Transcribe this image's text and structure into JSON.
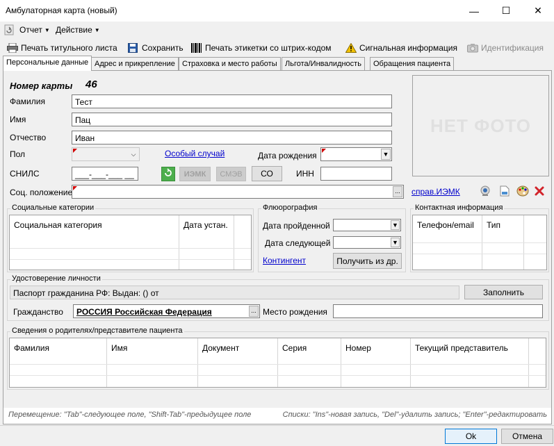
{
  "window": {
    "title": "Амбулаторная карта (новый)",
    "minimize": "—",
    "maximize": "☐",
    "close": "✕"
  },
  "menu": {
    "items": [
      {
        "label": "Отчет"
      },
      {
        "label": "Действие"
      }
    ]
  },
  "toolbar": {
    "print_title": "Печать титульного листа",
    "save": "Сохранить",
    "print_barcode": "Печать этикетки со штрих-кодом",
    "signal_info": "Сигнальная информация",
    "identification": "Идентификация"
  },
  "tabs": [
    {
      "label": "Персональные данные",
      "active": true
    },
    {
      "label": "Адрес и прикрепление"
    },
    {
      "label": "Страховка и место работы"
    },
    {
      "label": "Льгота/Инвалидность"
    },
    {
      "label": "Обращения пациента"
    }
  ],
  "personal": {
    "card_number_label": "Номер карты",
    "card_number": "46",
    "surname_label": "Фамилия",
    "surname": "Тест",
    "name_label": "Имя",
    "name": "Пац",
    "patronymic_label": "Отчество",
    "patronymic": "Иван",
    "sex_label": "Пол",
    "sex": "",
    "special_case_link": "Особый случай",
    "birth_date_label": "Дата рождения",
    "birth_date": "",
    "snils_label": "СНИЛС",
    "snils": "___-___-___ __",
    "iemk_button": "ИЭМК",
    "smev_button": "СМЭВ",
    "co_button": "СО",
    "inn_label": "ИНН",
    "inn": "",
    "social_status_label": "Соц. положение",
    "social_status": "",
    "sprav_iemk_link": "справ.ИЭМК",
    "no_photo": "НЕТ ФОТО"
  },
  "social_categories": {
    "title": "Социальные категории",
    "columns": [
      "Социальная категория",
      "Дата устан."
    ]
  },
  "fluoro": {
    "title": "Флюорография",
    "date_done_label": "Дата пройденной",
    "date_next_label": "Дата следующей",
    "contingent_link": "Контингент",
    "get_from_button": "Получить из др."
  },
  "contacts": {
    "title": "Контактная информация",
    "columns": [
      "Телефон/email",
      "Тип"
    ]
  },
  "identity": {
    "title": "Удостоверение личности",
    "document": "Паспорт гражданина РФ:  Выдан: () от",
    "fill_button": "Заполнить",
    "citizenship_label": "Гражданство",
    "citizenship": "РОССИЯ Российская Федерация",
    "birthplace_label": "Место рождения",
    "birthplace": ""
  },
  "parents": {
    "title": "Сведения о родителях/представителе пациента",
    "columns": [
      "Фамилия",
      "Имя",
      "Документ",
      "Серия",
      "Номер",
      "Текущий представитель"
    ]
  },
  "status": {
    "left": "Перемещение: \"Tab\"-следующее поле, \"Shift-Tab\"-предыдущее поле",
    "right": "Списки: \"Ins\"-новая запись, \"Del\"-удалить запись; \"Enter\"-редактировать"
  },
  "buttons": {
    "ok": "Ok",
    "cancel": "Отмена"
  }
}
